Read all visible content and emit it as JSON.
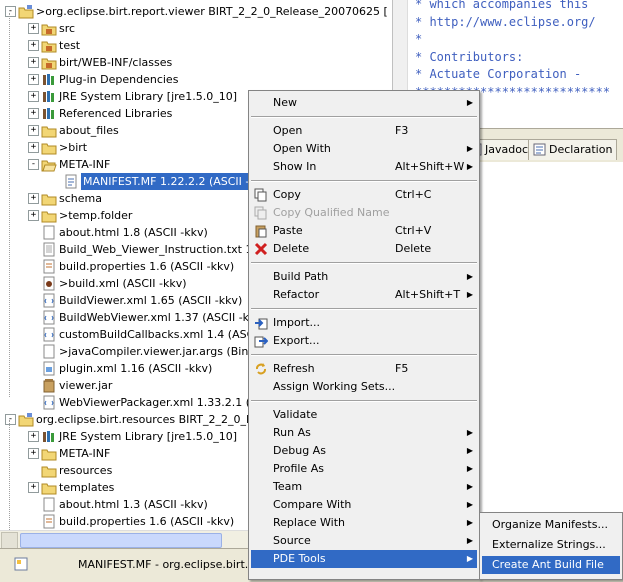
{
  "tree": {
    "items": [
      {
        "label": ">org.eclipse.birt.report.viewer  BIRT_2_2_0_Release_20070625 [",
        "level": 0,
        "toggle": "-",
        "icon": "project-icon"
      },
      {
        "label": "src",
        "level": 1,
        "toggle": "+",
        "icon": "source-folder-icon"
      },
      {
        "label": "test",
        "level": 1,
        "toggle": "+",
        "icon": "source-folder-icon"
      },
      {
        "label": "birt/WEB-INF/classes",
        "level": 1,
        "toggle": "+",
        "icon": "source-folder-icon"
      },
      {
        "label": "Plug-in Dependencies",
        "level": 1,
        "toggle": "+",
        "icon": "library-icon"
      },
      {
        "label": "JRE System Library [jre1.5.0_10]",
        "level": 1,
        "toggle": "+",
        "icon": "library-icon"
      },
      {
        "label": "Referenced Libraries",
        "level": 1,
        "toggle": "+",
        "icon": "library-icon"
      },
      {
        "label": "about_files",
        "level": 1,
        "toggle": "+",
        "icon": "folder-icon"
      },
      {
        "label": ">birt",
        "level": 1,
        "toggle": "+",
        "icon": "folder-icon"
      },
      {
        "label": "META-INF",
        "level": 1,
        "toggle": "-",
        "icon": "folder-open-icon"
      },
      {
        "label": "MANIFEST.MF  1.22.2.2  (ASCII -kk",
        "level": 2,
        "toggle": "",
        "icon": "manifest-file-icon",
        "selected": true
      },
      {
        "label": "schema",
        "level": 1,
        "toggle": "+",
        "icon": "folder-icon"
      },
      {
        "label": ">temp.folder",
        "level": 1,
        "toggle": "+",
        "icon": "folder-icon"
      },
      {
        "label": "about.html  1.8  (ASCII -kkv)",
        "level": 1,
        "toggle": "",
        "icon": "file-icon"
      },
      {
        "label": "Build_Web_Viewer_Instruction.txt  1.3",
        "level": 1,
        "toggle": "",
        "icon": "text-file-icon"
      },
      {
        "label": "build.properties  1.6  (ASCII -kkv)",
        "level": 1,
        "toggle": "",
        "icon": "properties-file-icon"
      },
      {
        "label": ">build.xml    (ASCII -kkv)",
        "level": 1,
        "toggle": "",
        "icon": "ant-file-icon"
      },
      {
        "label": "BuildViewer.xml  1.65  (ASCII -kkv)",
        "level": 1,
        "toggle": "",
        "icon": "xml-file-icon"
      },
      {
        "label": "BuildWebViewer.xml  1.37  (ASCII -kkv)",
        "level": 1,
        "toggle": "",
        "icon": "xml-file-icon"
      },
      {
        "label": "customBuildCallbacks.xml  1.4  (ASCII -",
        "level": 1,
        "toggle": "",
        "icon": "xml-file-icon"
      },
      {
        "label": ">javaCompiler.viewer.jar.args    (Bina",
        "level": 1,
        "toggle": "",
        "icon": "file-icon"
      },
      {
        "label": "plugin.xml  1.16  (ASCII -kkv)",
        "level": 1,
        "toggle": "",
        "icon": "plugin-file-icon"
      },
      {
        "label": "viewer.jar",
        "level": 1,
        "toggle": "",
        "icon": "jar-file-icon"
      },
      {
        "label": "WebViewerPackager.xml  1.33.2.1  (ASCII",
        "level": 1,
        "toggle": "",
        "icon": "xml-file-icon"
      },
      {
        "label": "org.eclipse.birt.resources  BIRT_2_2_0_Re",
        "level": 0,
        "toggle": "-",
        "icon": "project-icon"
      },
      {
        "label": "JRE System Library [jre1.5.0_10]",
        "level": 1,
        "toggle": "+",
        "icon": "library-icon"
      },
      {
        "label": "META-INF",
        "level": 1,
        "toggle": "+",
        "icon": "folder-icon"
      },
      {
        "label": "resources",
        "level": 1,
        "toggle": "",
        "icon": "folder-icon"
      },
      {
        "label": "templates",
        "level": 1,
        "toggle": "+",
        "icon": "folder-icon"
      },
      {
        "label": "about.html  1.3  (ASCII -kkv)",
        "level": 1,
        "toggle": "",
        "icon": "file-icon"
      },
      {
        "label": "build.properties  1.6  (ASCII -kkv)",
        "level": 1,
        "toggle": "",
        "icon": "properties-file-icon"
      }
    ]
  },
  "editor": {
    "lines": [
      " * which accompanies this",
      " * http://www.eclipse.org/",
      " *",
      " * Contributors:",
      " *  Actuate Corporation  -",
      " ***************************"
    ]
  },
  "tabs": [
    {
      "label": "Javadoc",
      "icon": "javadoc-icon"
    },
    {
      "label": "Declaration",
      "icon": "declaration-icon"
    }
  ],
  "status": {
    "text": "MANIFEST.MF - org.eclipse.birt.rep"
  },
  "context_menu": {
    "groups": [
      [
        {
          "label": "New",
          "submenu": true
        }
      ],
      [
        {
          "label": "Open",
          "shortcut": "F3"
        },
        {
          "label": "Open With",
          "submenu": true
        },
        {
          "label": "Show In",
          "shortcut": "Alt+Shift+W",
          "submenu": true
        }
      ],
      [
        {
          "label": "Copy",
          "shortcut": "Ctrl+C",
          "icon": "copy-icon"
        },
        {
          "label": "Copy Qualified Name",
          "disabled": true,
          "icon": "copy-qualified-icon"
        },
        {
          "label": "Paste",
          "shortcut": "Ctrl+V",
          "icon": "paste-icon"
        },
        {
          "label": "Delete",
          "shortcut": "Delete",
          "icon": "delete-icon"
        }
      ],
      [
        {
          "label": "Build Path",
          "submenu": true
        },
        {
          "label": "Refactor",
          "shortcut": "Alt+Shift+T",
          "submenu": true
        }
      ],
      [
        {
          "label": "Import...",
          "icon": "import-icon"
        },
        {
          "label": "Export...",
          "icon": "export-icon"
        }
      ],
      [
        {
          "label": "Refresh",
          "shortcut": "F5",
          "icon": "refresh-icon"
        },
        {
          "label": "Assign Working Sets..."
        }
      ],
      [
        {
          "label": "Validate"
        },
        {
          "label": "Run As",
          "submenu": true
        },
        {
          "label": "Debug As",
          "submenu": true
        },
        {
          "label": "Profile As",
          "submenu": true
        },
        {
          "label": "Team",
          "submenu": true
        },
        {
          "label": "Compare With",
          "submenu": true
        },
        {
          "label": "Replace With",
          "submenu": true
        },
        {
          "label": "Source",
          "submenu": true
        },
        {
          "label": "PDE Tools",
          "submenu": true,
          "highlighted": true
        }
      ]
    ]
  },
  "submenu": {
    "items": [
      {
        "label": "Organize Manifests..."
      },
      {
        "label": "Externalize Strings..."
      },
      {
        "label": "Create Ant Build File",
        "highlighted": true
      }
    ]
  },
  "colors": {
    "selection": "#316ac5",
    "comment": "#3f5fbf",
    "menu_bg": "#f0f0f0",
    "chrome": "#ece9d8"
  }
}
